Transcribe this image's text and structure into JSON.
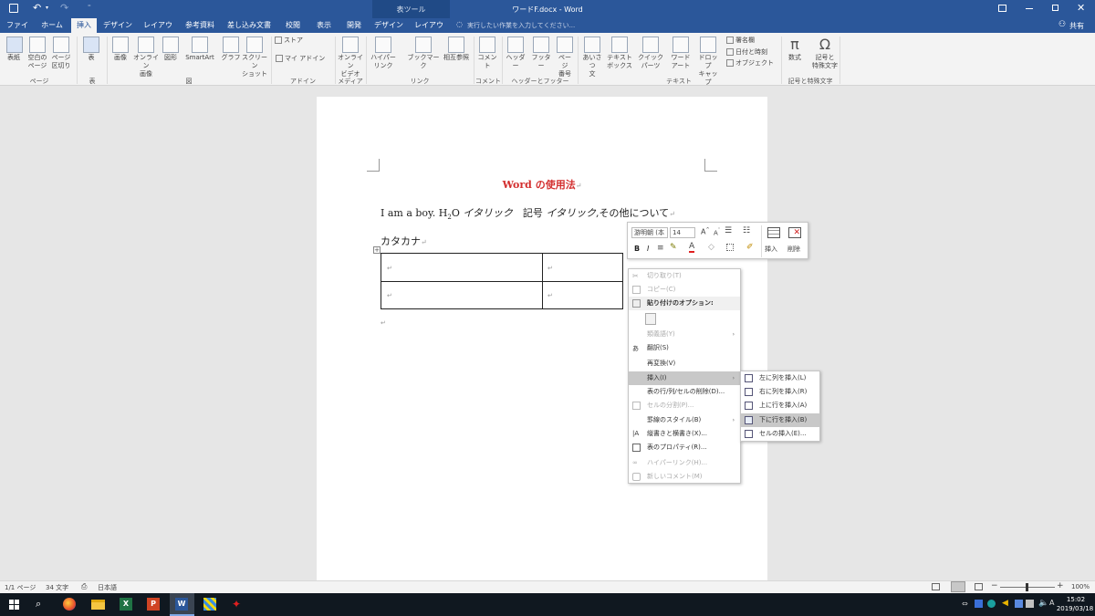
{
  "titlebar": {
    "title": "ワードF.docx - Word",
    "context_tab_group": "表ツール"
  },
  "tabs": [
    "ファイル",
    "ホーム",
    "挿入",
    "デザイン",
    "レイアウト",
    "参考資料",
    "差し込み文書",
    "校閲",
    "表示",
    "開発",
    "デザイン",
    "レイアウト"
  ],
  "tell_me": "実行したい作業を入力してください...",
  "share_label": "共有",
  "ribbon": {
    "buttons": [
      {
        "label": "表紙",
        "sub": ""
      },
      {
        "label": "空白の",
        "sub": "ページ"
      },
      {
        "label": "ページ",
        "sub": "区切り"
      },
      {
        "label": "表",
        "sub": ""
      },
      {
        "label": "画像",
        "sub": ""
      },
      {
        "label": "オンライン",
        "sub": "画像"
      },
      {
        "label": "図形",
        "sub": ""
      },
      {
        "label": "SmartArt",
        "sub": ""
      },
      {
        "label": "グラフ",
        "sub": ""
      },
      {
        "label": "スクリーン",
        "sub": "ショット"
      },
      {
        "label": "ストア",
        "sub": ""
      },
      {
        "label": "マイ アドイン",
        "sub": ""
      },
      {
        "label": "オンライン",
        "sub": "ビデオ"
      },
      {
        "label": "ハイパーリンク",
        "sub": ""
      },
      {
        "label": "ブックマーク",
        "sub": ""
      },
      {
        "label": "相互参照",
        "sub": ""
      },
      {
        "label": "コメント",
        "sub": ""
      },
      {
        "label": "ヘッダー",
        "sub": ""
      },
      {
        "label": "フッター",
        "sub": ""
      },
      {
        "label": "ページ",
        "sub": "番号"
      },
      {
        "label": "あいさつ",
        "sub": "文"
      },
      {
        "label": "テキスト",
        "sub": "ボックス"
      },
      {
        "label": "クイック パーツ",
        "sub": ""
      },
      {
        "label": "ワード",
        "sub": "アート"
      },
      {
        "label": "ドロップ",
        "sub": "キャップ"
      },
      {
        "label": "署名欄",
        "sub": ""
      },
      {
        "label": "日付と時刻",
        "sub": ""
      },
      {
        "label": "オブジェクト",
        "sub": ""
      },
      {
        "label": "数式",
        "sub": ""
      },
      {
        "label": "記号と",
        "sub": "特殊文字"
      }
    ],
    "groups": [
      "ページ",
      "表",
      "図",
      "アドイン",
      "メディア",
      "リンク",
      "コメント",
      "ヘッダーとフッター",
      "テキスト",
      "記号と特殊文字"
    ]
  },
  "document": {
    "title": "Word の使用法",
    "line1_a": "I am a boy. H",
    "line1_sub": "2",
    "line1_b": "O ",
    "line1_italic1": "イタリック",
    "line1_c": "　記号 ",
    "line1_italic2": "イタリック",
    "line1_d": ",その他について",
    "line2": "カタカナ",
    "para_mark": "↵"
  },
  "mini_toolbar": {
    "font": "游明朝 (本",
    "size": "14",
    "insert": "挿入",
    "delete": "削除",
    "bold": "B",
    "italic": "I"
  },
  "context_menu": [
    {
      "label": "切り取り(T)",
      "disabled": true
    },
    {
      "label": "コピー(C)",
      "disabled": true
    },
    {
      "label": "貼り付けのオプション:",
      "disabled": false
    },
    {
      "label": "類義語(Y)",
      "disabled": true
    },
    {
      "label": "翻訳(S)",
      "disabled": false
    },
    {
      "label": "再変換(V)",
      "disabled": false
    },
    {
      "label": "挿入(I)",
      "disabled": false
    },
    {
      "label": "表の行/列/セルの削除(D)...",
      "disabled": false
    },
    {
      "label": "セルの分割(P)...",
      "disabled": true
    },
    {
      "label": "罫線のスタイル(B)",
      "disabled": false
    },
    {
      "label": "縦書きと横書き(X)...",
      "disabled": false
    },
    {
      "label": "表のプロパティ(R)...",
      "disabled": false
    },
    {
      "label": "ハイパーリンク(H)...",
      "disabled": true
    },
    {
      "label": "新しいコメント(M)",
      "disabled": true
    }
  ],
  "submenu": [
    "左に列を挿入(L)",
    "右に列を挿入(R)",
    "上に行を挿入(A)",
    "下に行を挿入(B)",
    "セルの挿入(E)..."
  ],
  "statusbar": {
    "page": "1/1 ページ",
    "words": "34 文字",
    "lang": "日本語",
    "zoom": "100%"
  },
  "taskbar": {
    "time": "15:02",
    "date": "2019/03/18"
  },
  "colors": {
    "accent": "#2b579a",
    "title_red": "#d32f2f"
  }
}
